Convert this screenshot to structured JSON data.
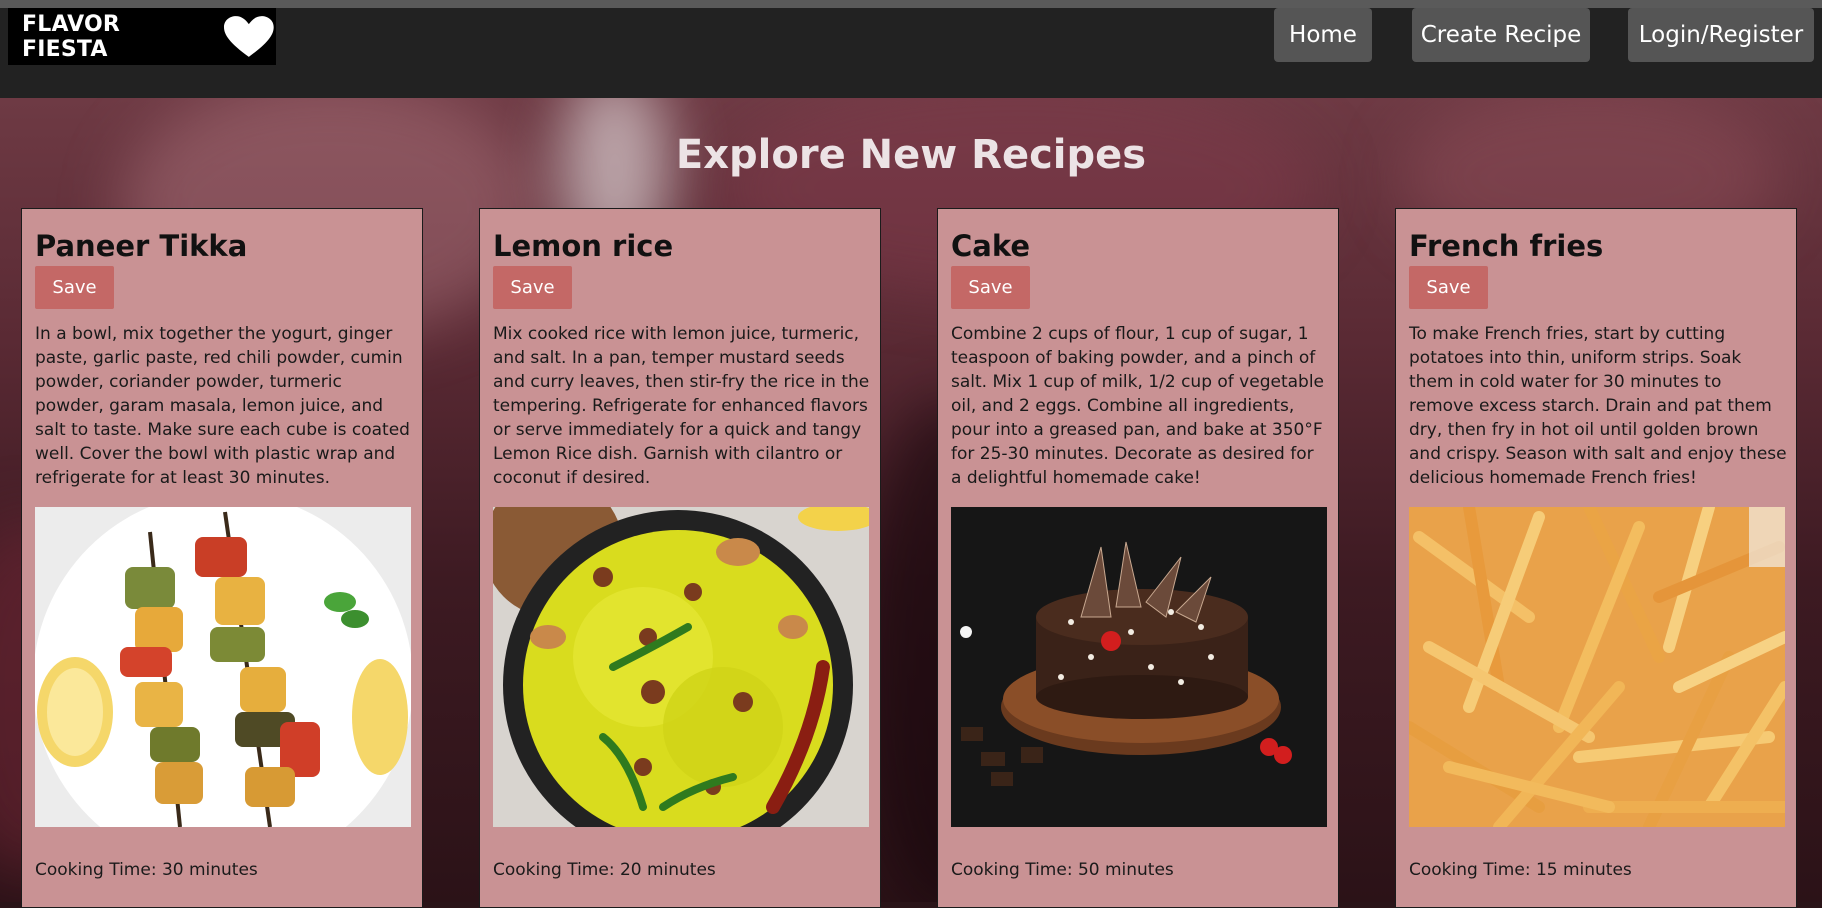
{
  "brand": {
    "name": "FLAVOR FIESTA"
  },
  "nav": {
    "home": "Home",
    "create": "Create Recipe",
    "login": "Login/Register"
  },
  "page": {
    "title": "Explore New Recipes"
  },
  "recipes": [
    {
      "title": "Paneer Tikka",
      "save": "Save",
      "description": "In a bowl, mix together the yogurt, ginger paste, garlic paste, red chili powder, cumin powder, coriander powder, turmeric powder, garam masala, lemon juice, and salt to taste. Make sure each cube is coated well. Cover the bowl with plastic wrap and refrigerate for at least 30 minutes.",
      "cooking_time": "Cooking Time: 30 minutes"
    },
    {
      "title": "Lemon rice",
      "save": "Save",
      "description": "Mix cooked rice with lemon juice, turmeric, and salt. In a pan, temper mustard seeds and curry leaves, then stir-fry the rice in the tempering. Refrigerate for enhanced flavors or serve immediately for a quick and tangy Lemon Rice dish. Garnish with cilantro or coconut if desired.",
      "cooking_time": "Cooking Time: 20 minutes"
    },
    {
      "title": "Cake",
      "save": "Save",
      "description": "Combine 2 cups of flour, 1 cup of sugar, 1 teaspoon of baking powder, and a pinch of salt. Mix 1 cup of milk, 1/2 cup of vegetable oil, and 2 eggs. Combine all ingredients, pour into a greased pan, and bake at 350°F for 25-30 minutes. Decorate as desired for a delightful homemade cake!",
      "cooking_time": "Cooking Time: 50 minutes"
    },
    {
      "title": "French fries",
      "save": "Save",
      "description": "To make French fries, start by cutting potatoes into thin, uniform strips. Soak them in cold water for 30 minutes to remove excess starch. Drain and pat them dry, then fry in hot oil until golden brown and crispy. Season with salt and enjoy these delicious homemade French fries!",
      "cooking_time": "Cooking Time: 15 minutes"
    }
  ]
}
